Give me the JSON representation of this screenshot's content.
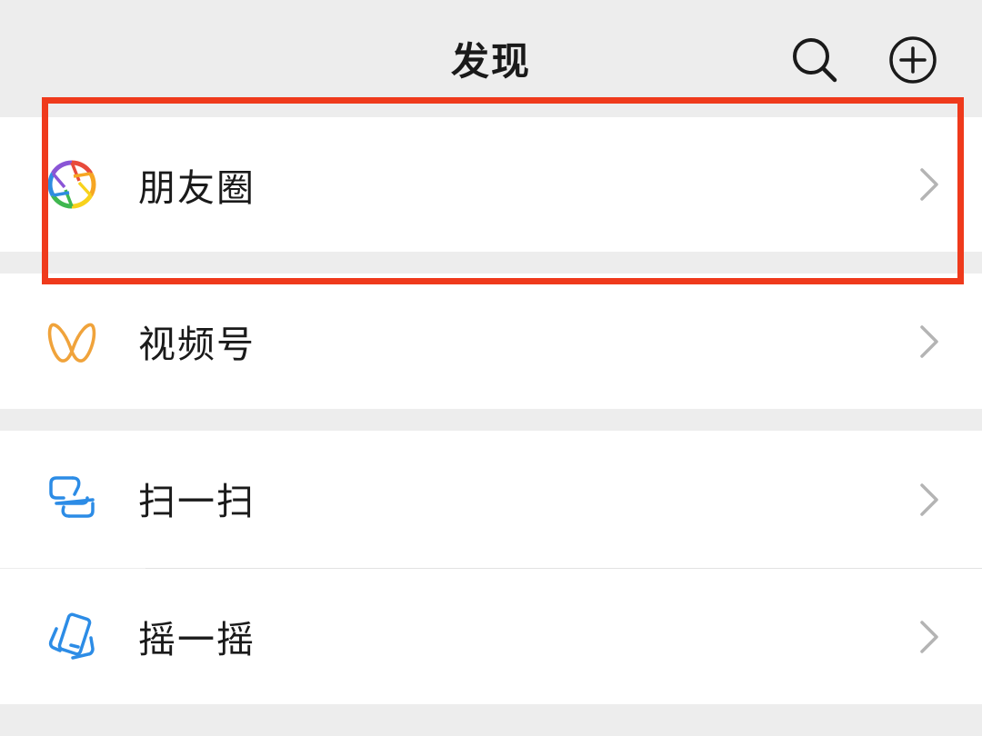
{
  "header": {
    "title": "发现",
    "search_icon": "search-icon",
    "add_icon": "plus-circle-icon"
  },
  "items": [
    {
      "label": "朋友圈",
      "icon": "moments-aperture-icon"
    },
    {
      "label": "视频号",
      "icon": "channels-icon"
    },
    {
      "label": "扫一扫",
      "icon": "scan-icon"
    },
    {
      "label": "摇一摇",
      "icon": "shake-icon"
    }
  ],
  "colors": {
    "background": "#ededed",
    "row": "#ffffff",
    "text": "#1a1a1a",
    "chevron": "#b4b4b4",
    "highlight": "#ef3a1c",
    "channels_icon": "#f0a33b",
    "scan_icon": "#2c8ce6"
  }
}
